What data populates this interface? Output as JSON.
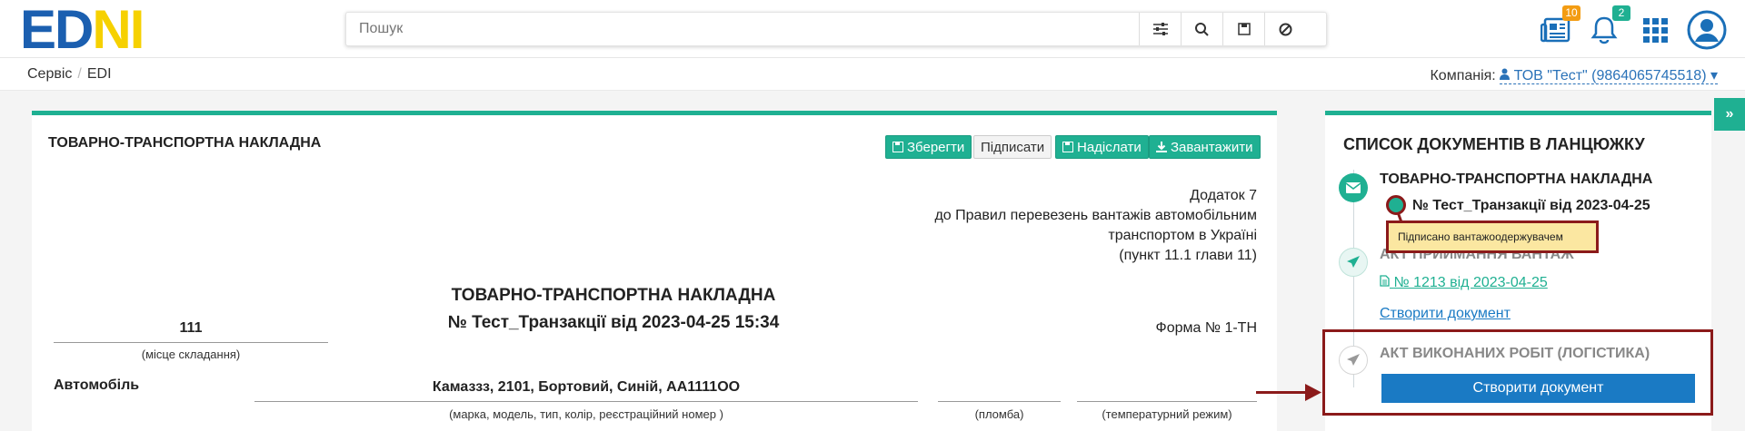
{
  "logo": {
    "part1": "ED",
    "part2": "NI"
  },
  "search": {
    "placeholder": "Пошук"
  },
  "header": {
    "news_badge": "10",
    "notifications_badge": "2"
  },
  "breadcrumb": {
    "items": [
      "Сервіс",
      "EDI"
    ]
  },
  "company": {
    "label": "Компанія:",
    "value": "ТОВ \"Тест\" (9864065745518)"
  },
  "document": {
    "header_title": "ТОВАРНО-ТРАНСПОРТНА НАКЛАДНА",
    "buttons": {
      "save": "Зберегти",
      "sign": "Підписати",
      "send": "Надіслати",
      "download": "Завантажити"
    },
    "appendix": [
      "Додаток 7",
      "до Правил перевезень вантажів автомобільним",
      "транспортом в Україні",
      "(пункт 11.1 глави 11)"
    ],
    "main_title": "ТОВАРНО-ТРАНСПОРТНА НАКЛАДНА",
    "number_line": "№ Тест_Транзакції від 2023-04-25 15:34",
    "place_value": "111",
    "place_caption": "(місце складання)",
    "form_number": "Форма № 1-ТН",
    "vehicle_label": "Автомобіль",
    "vehicle_value": "Камаззз, 2101, Бортовий, Синій, АА1111ОО",
    "vehicle_caption": "(марка, модель, тип, колір, реєстраційний номер )",
    "seal_caption": "(пломба)",
    "temp_caption": "(температурний режим)"
  },
  "chain": {
    "title": "СПИСОК ДОКУМЕНТІВ В ЛАНЦЮЖКУ",
    "items": [
      {
        "title": "ТОВАРНО-ТРАНСПОРТНА НАКЛАДНА",
        "doc": "№ Тест_Транзакції від 2023-04-25"
      },
      {
        "title": "АКТ ПРИЙМАННЯ ВАНТАЖ",
        "doc": "№ 1213 від 2023-04-25",
        "create": "Створити документ"
      },
      {
        "title": "АКТ ВИКОНАНИХ РОБІТ (ЛОГІСТИКА)",
        "create": "Створити документ"
      }
    ],
    "tooltip": "Підписано вантажоодержувачем"
  },
  "colors": {
    "accent": "#1fb092",
    "brand": "#1b5fb0",
    "highlight": "#8b1a1a",
    "primary_button": "#1a7ac4"
  },
  "toggle": {
    "label": "»"
  }
}
